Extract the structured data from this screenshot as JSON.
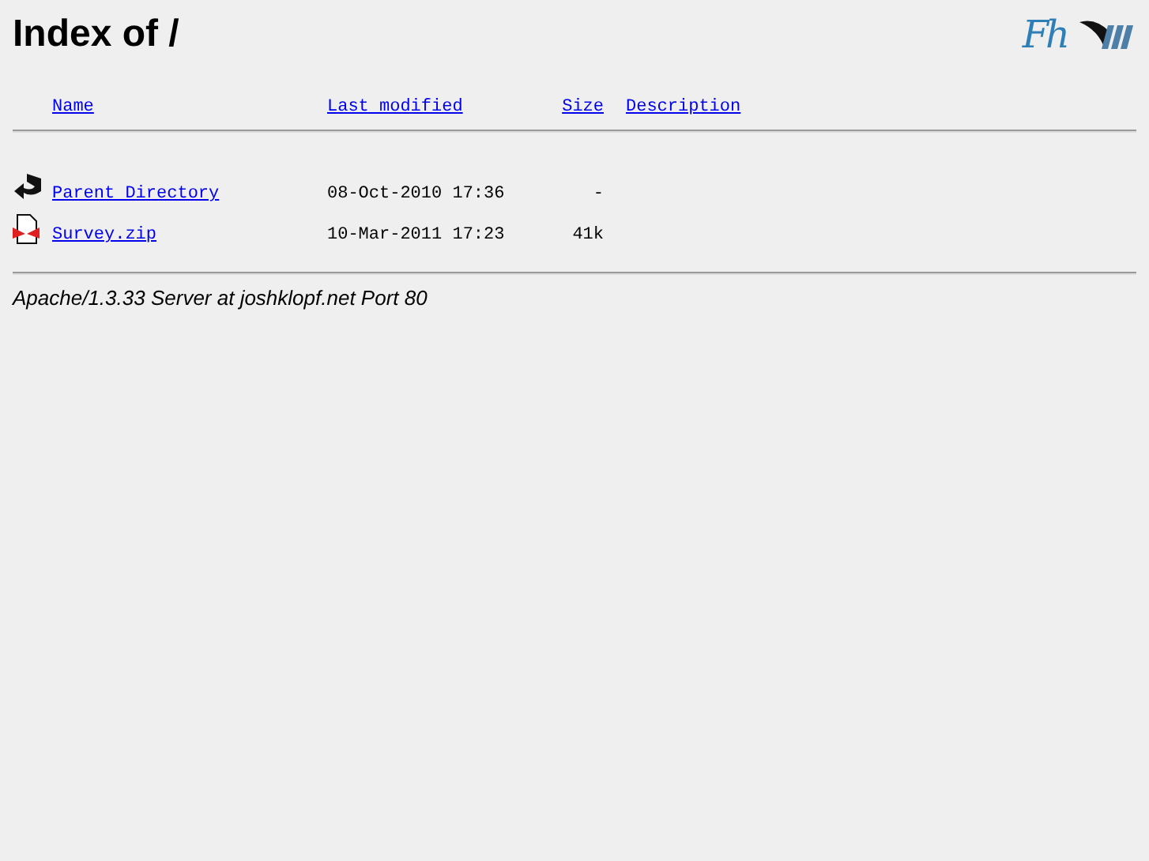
{
  "title": "Index of /",
  "logo_text": "Fh",
  "columns": [
    "Name",
    "Last modified",
    "Size",
    "Description"
  ],
  "rows": [
    {
      "kind": "back",
      "name": "Parent Directory",
      "modified": "08-Oct-2010 17:36",
      "size": "-"
    },
    {
      "kind": "zip",
      "name": "Survey.zip",
      "modified": "10-Mar-2011 17:23",
      "size": "41k"
    }
  ],
  "footer": "Apache/1.3.33 Server at joshklopf.net Port 80"
}
